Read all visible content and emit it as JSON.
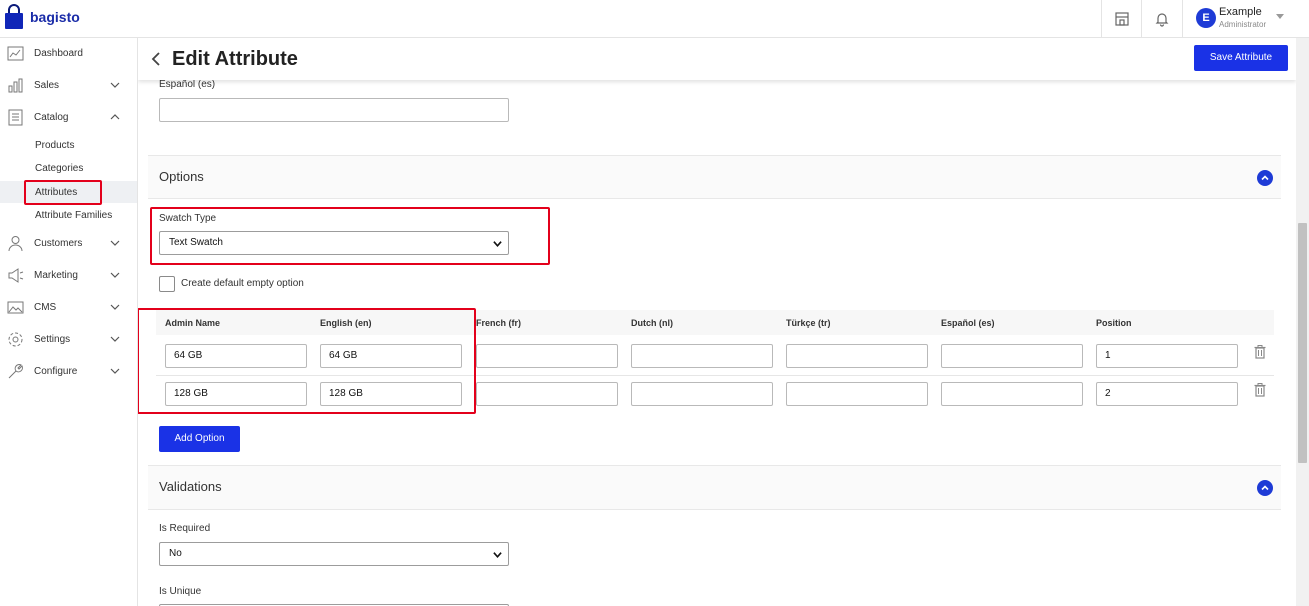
{
  "app": {
    "name": "bagisto"
  },
  "user": {
    "initial": "E",
    "name": "Example",
    "role": "Administrator"
  },
  "sidebar": {
    "items": [
      {
        "label": "Dashboard",
        "icon": "dashboard-icon"
      },
      {
        "label": "Sales",
        "icon": "sales-icon"
      },
      {
        "label": "Catalog",
        "icon": "catalog-icon"
      },
      {
        "label": "Customers",
        "icon": "customers-icon"
      },
      {
        "label": "Marketing",
        "icon": "marketing-icon"
      },
      {
        "label": "CMS",
        "icon": "cms-icon"
      },
      {
        "label": "Settings",
        "icon": "settings-icon"
      },
      {
        "label": "Configure",
        "icon": "configure-icon"
      }
    ],
    "catalog_sub": [
      {
        "label": "Products"
      },
      {
        "label": "Categories"
      },
      {
        "label": "Attributes",
        "active": true
      },
      {
        "label": "Attribute Families"
      }
    ]
  },
  "page": {
    "title": "Edit Attribute",
    "save_label": "Save Attribute"
  },
  "espanol_field": {
    "label": "Español (es)",
    "value": ""
  },
  "options_section": {
    "title": "Options",
    "swatch_type_label": "Swatch Type",
    "swatch_type_value": "Text Swatch",
    "default_empty_label": "Create default empty option",
    "default_empty_checked": false,
    "columns": [
      "Admin Name",
      "English (en)",
      "French (fr)",
      "Dutch (nl)",
      "Türkçe (tr)",
      "Español (es)",
      "Position"
    ],
    "rows": [
      {
        "admin": "64 GB",
        "en": "64 GB",
        "fr": "",
        "nl": "",
        "tr": "",
        "es": "",
        "position": "1"
      },
      {
        "admin": "128 GB",
        "en": "128 GB",
        "fr": "",
        "nl": "",
        "tr": "",
        "es": "",
        "position": "2"
      }
    ],
    "add_option_label": "Add Option"
  },
  "validations_section": {
    "title": "Validations",
    "is_required_label": "Is Required",
    "is_required_value": "No",
    "is_unique_label": "Is Unique"
  },
  "colors": {
    "accent": "#1a32e6",
    "highlight": "#e3001b"
  }
}
